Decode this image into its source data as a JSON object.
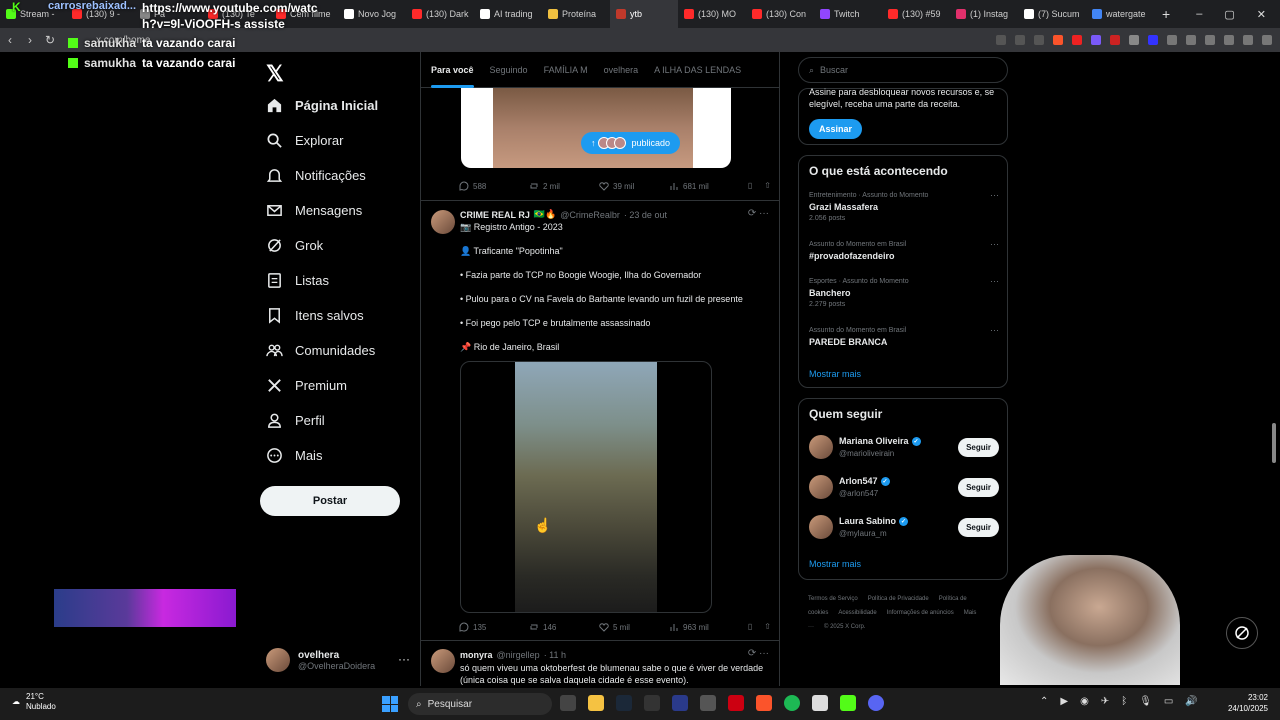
{
  "browser": {
    "tabs": [
      {
        "label": "Stream -",
        "color": "#53fc18"
      },
      {
        "label": "(130) 9 -",
        "color": "#ff2a2a"
      },
      {
        "label": "Pa",
        "color": "#888"
      },
      {
        "label": "(130) Te",
        "color": "#ff2a2a"
      },
      {
        "label": "Cem filme",
        "color": "#ff2a2a"
      },
      {
        "label": "Novo Jog",
        "color": "#ffffff"
      },
      {
        "label": "(130) Dark",
        "color": "#ff2a2a"
      },
      {
        "label": "AI trading",
        "color": "#ffffff"
      },
      {
        "label": "Proteína",
        "color": "#f0c040"
      },
      {
        "label": "ytb",
        "color": "#c0392b"
      },
      {
        "label": "(130) MO",
        "color": "#ff2a2a"
      },
      {
        "label": "(130) Con",
        "color": "#ff2a2a"
      },
      {
        "label": "Twitch",
        "color": "#9146ff"
      },
      {
        "label": "(130) #59",
        "color": "#ff2a2a"
      },
      {
        "label": "(1) Instag",
        "color": "#e1306c"
      },
      {
        "label": "(7) Sucum",
        "color": "#ffffff"
      },
      {
        "label": "watergate",
        "color": "#4285f4"
      }
    ],
    "new_tab": "+",
    "url": "x.com/home"
  },
  "overlay": {
    "title": "carrosrebaixad...",
    "url_text_1": "https://www.youtube.com/watc",
    "url_text_2": "h?v=9l-ViOOFH-s assiste",
    "chat": [
      {
        "user": "samukha",
        "msg": "ta vazando carai"
      },
      {
        "user": "samukha",
        "msg": "ta vazando carai"
      }
    ]
  },
  "sidebar": {
    "items": [
      {
        "label": "Página Inicial",
        "icon": "home-icon"
      },
      {
        "label": "Explorar",
        "icon": "search-icon"
      },
      {
        "label": "Notificações",
        "icon": "bell-icon"
      },
      {
        "label": "Mensagens",
        "icon": "mail-icon"
      },
      {
        "label": "Grok",
        "icon": "grok-icon"
      },
      {
        "label": "Listas",
        "icon": "list-icon"
      },
      {
        "label": "Itens salvos",
        "icon": "bookmark-icon"
      },
      {
        "label": "Comunidades",
        "icon": "people-icon"
      },
      {
        "label": "Premium",
        "icon": "x-logo-icon"
      },
      {
        "label": "Perfil",
        "icon": "person-icon"
      },
      {
        "label": "Mais",
        "icon": "more-icon"
      }
    ],
    "post_button": "Postar",
    "user": {
      "name": "ovelhera",
      "handle": "@OvelheraDoidera"
    }
  },
  "feed": {
    "tabs": [
      "Para você",
      "Seguindo",
      "FAMÍLIA M",
      "ovelhera",
      "A ILHA DAS LENDAS"
    ],
    "pill": "publicado",
    "post1_actions": {
      "replies": "588",
      "reposts": "2 mil",
      "likes": "39 mil",
      "views": "681 mil"
    },
    "post2": {
      "name": "CRIME REAL RJ",
      "handle": "@CrimeRealbr",
      "date": "· 23 de out",
      "lines": [
        "📷 Registro Antigo - 2023",
        "👤 Traficante \"Popotinha\"",
        "• Fazia parte do TCP no Boogie Woogie, Ilha do Governador",
        "• Pulou para o CV na Favela do Barbante levando um fuzil de presente",
        "• Foi pego pelo TCP e brutalmente assassinado",
        "📌 Rio de Janeiro, Brasil"
      ],
      "actions": {
        "replies": "135",
        "reposts": "146",
        "likes": "5 mil",
        "views": "963 mil"
      }
    },
    "post3": {
      "name": "monyra",
      "handle": "@nirgellep",
      "date": "· 11 h",
      "line1": "só quem viveu uma oktoberfest de blumenau sabe o que é viver de verdade",
      "line2": "(única coisa que se salva daquela cidade é esse evento)."
    }
  },
  "right": {
    "search_placeholder": "Buscar",
    "premium_text": "Assine para desbloquear novos recursos e, se elegível, receba uma parte da receita.",
    "premium_button": "Assinar",
    "trends_title": "O que está acontecendo",
    "trends": [
      {
        "context": "Entretenimento · Assunto do Momento",
        "topic": "Grazi Massafera",
        "posts": "2.056 posts"
      },
      {
        "context": "Assunto do Momento em Brasil",
        "topic": "#provadofazendeiro",
        "posts": ""
      },
      {
        "context": "Esportes · Assunto do Momento",
        "topic": "Banchero",
        "posts": "2.279 posts"
      },
      {
        "context": "Assunto do Momento em Brasil",
        "topic": "PAREDE BRANCA",
        "posts": ""
      }
    ],
    "show_more": "Mostrar mais",
    "follow_title": "Quem seguir",
    "follow": [
      {
        "name": "Mariana Oliveira",
        "handle": "@marioliveirain",
        "button": "Seguir"
      },
      {
        "name": "Arlon547",
        "handle": "@arlon547",
        "button": "Seguir"
      },
      {
        "name": "Laura Sabino",
        "handle": "@mylaura_m",
        "button": "Seguir"
      }
    ],
    "follow_more": "Mostrar mais",
    "footer": [
      "Termos de Serviço",
      "Política de Privacidade",
      "Política de cookies",
      "Acessibilidade",
      "Informações de anúncios",
      "Mais ···",
      "© 2025 X Corp."
    ]
  },
  "taskbar": {
    "weather_temp": "21°C",
    "weather_desc": "Nublado",
    "search": "Pesquisar",
    "time": "23:02",
    "date": "24/10/2025"
  }
}
